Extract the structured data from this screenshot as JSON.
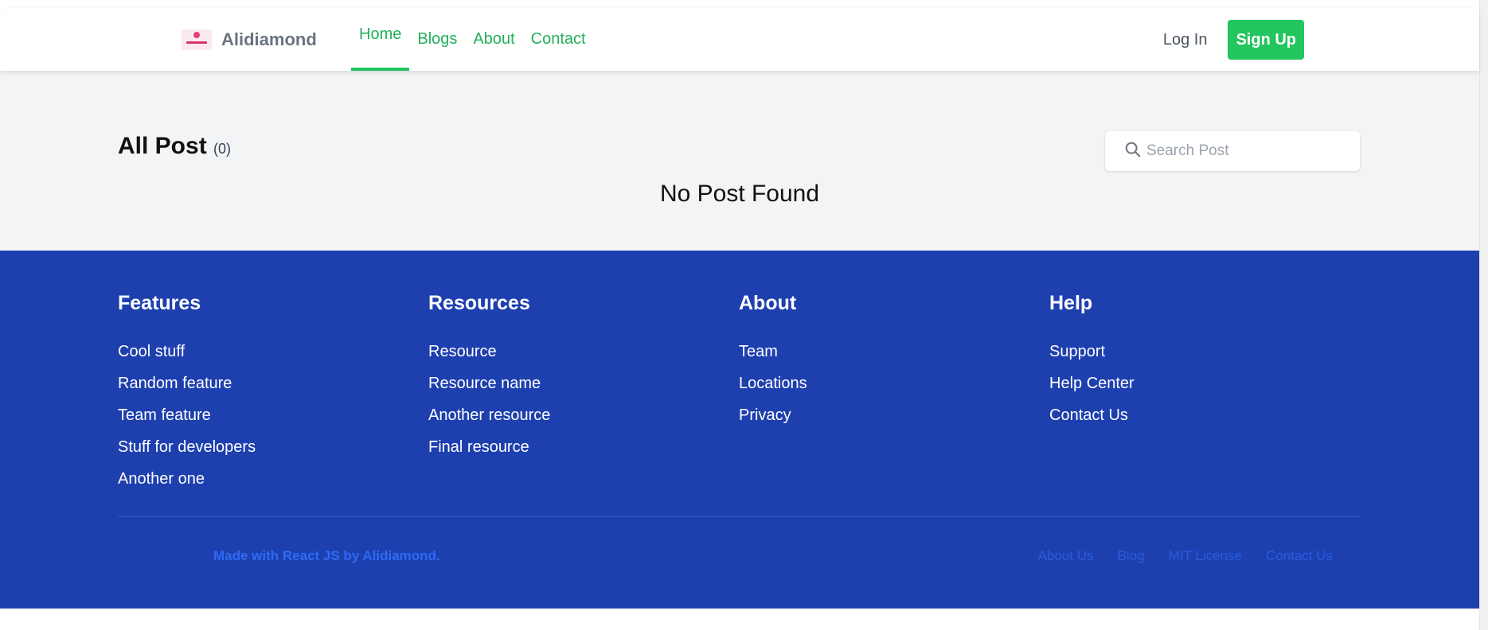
{
  "colors": {
    "accent_green": "#22c55e",
    "footer_blue": "#1e40af",
    "main_bg": "#f3f4f6"
  },
  "navbar": {
    "brand_name": "Alidiamond",
    "brand_icon": "alidiamond-logo",
    "links": [
      "Home",
      "Blogs",
      "About",
      "Contact"
    ],
    "active_link": "Home",
    "login_label": "Log In",
    "signup_label": "Sign Up"
  },
  "main": {
    "title": "All Post",
    "count": "(0)",
    "search": {
      "icon": "search-icon",
      "placeholder": "Search Post",
      "value": ""
    },
    "empty_message": "No Post Found"
  },
  "footer": {
    "columns": [
      {
        "heading": "Features",
        "items": [
          "Cool stuff",
          "Random feature",
          "Team feature",
          "Stuff for developers",
          "Another one"
        ]
      },
      {
        "heading": "Resources",
        "items": [
          "Resource",
          "Resource name",
          "Another resource",
          "Final resource"
        ]
      },
      {
        "heading": "About",
        "items": [
          "Team",
          "Locations",
          "Privacy"
        ]
      },
      {
        "heading": "Help",
        "items": [
          "Support",
          "Help Center",
          "Contact Us"
        ]
      }
    ],
    "copyright": "Made with React JS by Alidiamond.",
    "bottom_links": [
      "About Us",
      "Blog",
      "MIT License",
      "Contact Us"
    ]
  }
}
